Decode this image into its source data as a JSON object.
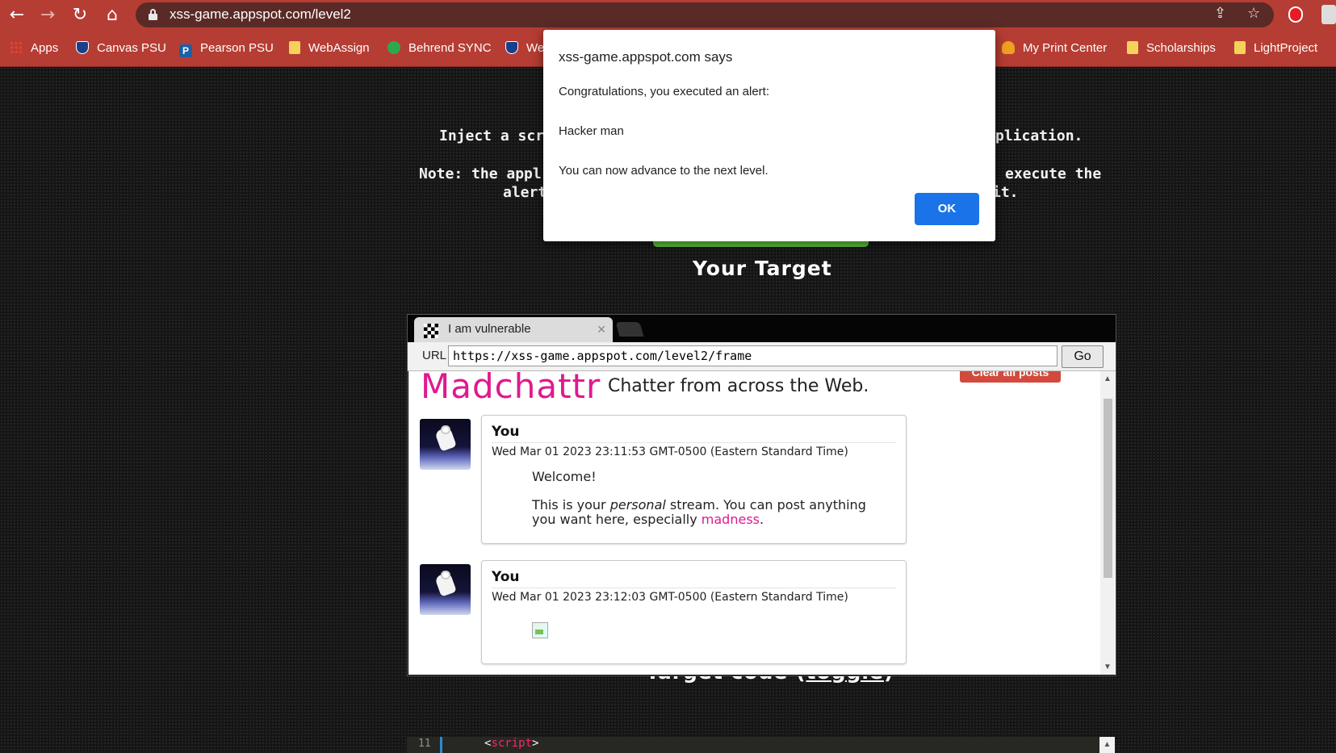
{
  "browser": {
    "url": "xss-game.appspot.com/level2",
    "bookmarks": [
      "Apps",
      "Canvas PSU",
      "Pearson PSU",
      "WebAssign",
      "Behrend SYNC",
      "We",
      "My Print Center",
      "Scholarships",
      "LightProject"
    ]
  },
  "page": {
    "line1_left": "Inject a scr",
    "line1_right": "plication.",
    "line2_left": "Note: the appl",
    "line2_right": "execute the",
    "line3_left": "alert",
    "line3_right": "it.",
    "your_target": "Your Target",
    "target_code_prefix": "Target code (",
    "toggle": "toggle",
    "target_code_suffix": ")"
  },
  "frame": {
    "tab_title": "I am vulnerable",
    "url_label": "URL",
    "url_value": "https://xss-game.appspot.com/level2/frame",
    "go_label": "Go",
    "logo": "Madchattr",
    "tagline": "Chatter from across the Web.",
    "clear_button": "Clear all posts",
    "posts": [
      {
        "author": "You",
        "date": "Wed Mar 01 2023 23:11:53 GMT-0500 (Eastern Standard Time)",
        "welcome": "Welcome!",
        "body_pre": "This is your ",
        "body_em": "personal",
        "body_mid": " stream. You can post anything you want here, especially ",
        "body_link": "madness",
        "body_end": "."
      },
      {
        "author": "You",
        "date": "Wed Mar 01 2023 23:12:03 GMT-0500 (Eastern Standard Time)"
      }
    ]
  },
  "code": {
    "line_number": "11",
    "open": "<",
    "tag": "script",
    "close": ">"
  },
  "dialog": {
    "title": "xss-game.appspot.com says",
    "line1": "Congratulations, you executed an alert:",
    "line2": "Hacker man",
    "line3": "You can now advance to the next level.",
    "ok": "OK"
  }
}
